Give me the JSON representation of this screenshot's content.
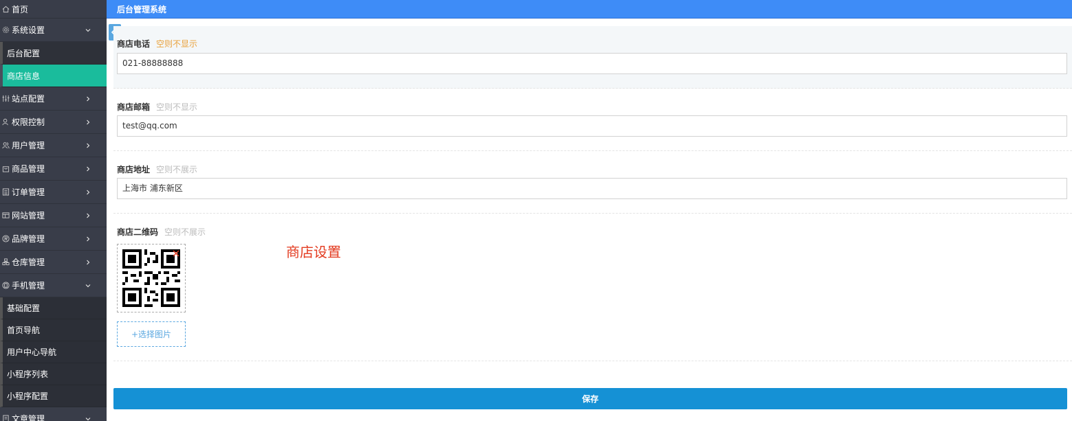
{
  "header": {
    "title": "后台管理系统"
  },
  "sidebar": {
    "items": [
      {
        "label": "首页",
        "icon": "home-icon"
      },
      {
        "label": "系统设置",
        "icon": "gear-icon",
        "expanded": true
      },
      {
        "label": "站点配置",
        "icon": "sliders-icon"
      },
      {
        "label": "权限控制",
        "icon": "user-shield-icon"
      },
      {
        "label": "用户管理",
        "icon": "users-icon"
      },
      {
        "label": "商品管理",
        "icon": "bag-icon"
      },
      {
        "label": "订单管理",
        "icon": "list-icon"
      },
      {
        "label": "网站管理",
        "icon": "window-icon"
      },
      {
        "label": "品牌管理",
        "icon": "registered-icon"
      },
      {
        "label": "仓库管理",
        "icon": "warehouse-icon"
      },
      {
        "label": "手机管理",
        "icon": "phone-icon",
        "expanded": true
      },
      {
        "label": "文章管理",
        "icon": "document-icon",
        "expanded": true
      }
    ],
    "system_sub": [
      {
        "label": "后台配置",
        "active": false
      },
      {
        "label": "商店信息",
        "active": true
      }
    ],
    "mobile_sub": [
      {
        "label": "基础配置"
      },
      {
        "label": "首页导航"
      },
      {
        "label": "用户中心导航"
      },
      {
        "label": "小程序列表"
      },
      {
        "label": "小程序配置"
      }
    ]
  },
  "form": {
    "phone": {
      "label": "商店电话",
      "hint": "空则不显示",
      "value": "021-88888888"
    },
    "email": {
      "label": "商店邮箱",
      "hint": "空则不显示",
      "value": "test@qq.com"
    },
    "address": {
      "label": "商店地址",
      "hint": "空则不展示",
      "value": "上海市 浦东新区"
    },
    "qrcode": {
      "label": "商店二维码",
      "hint": "空则不展示",
      "upload_label": "+选择图片"
    },
    "save_label": "保存"
  },
  "watermark": "商店设置",
  "colors": {
    "sidebar_bg": "#393d49",
    "active_item": "#1abc9c",
    "header_bg": "#3e8cf7",
    "save_button": "#1591d5",
    "hint_orange": "#e9a13b",
    "watermark_red": "#e33a1f"
  }
}
